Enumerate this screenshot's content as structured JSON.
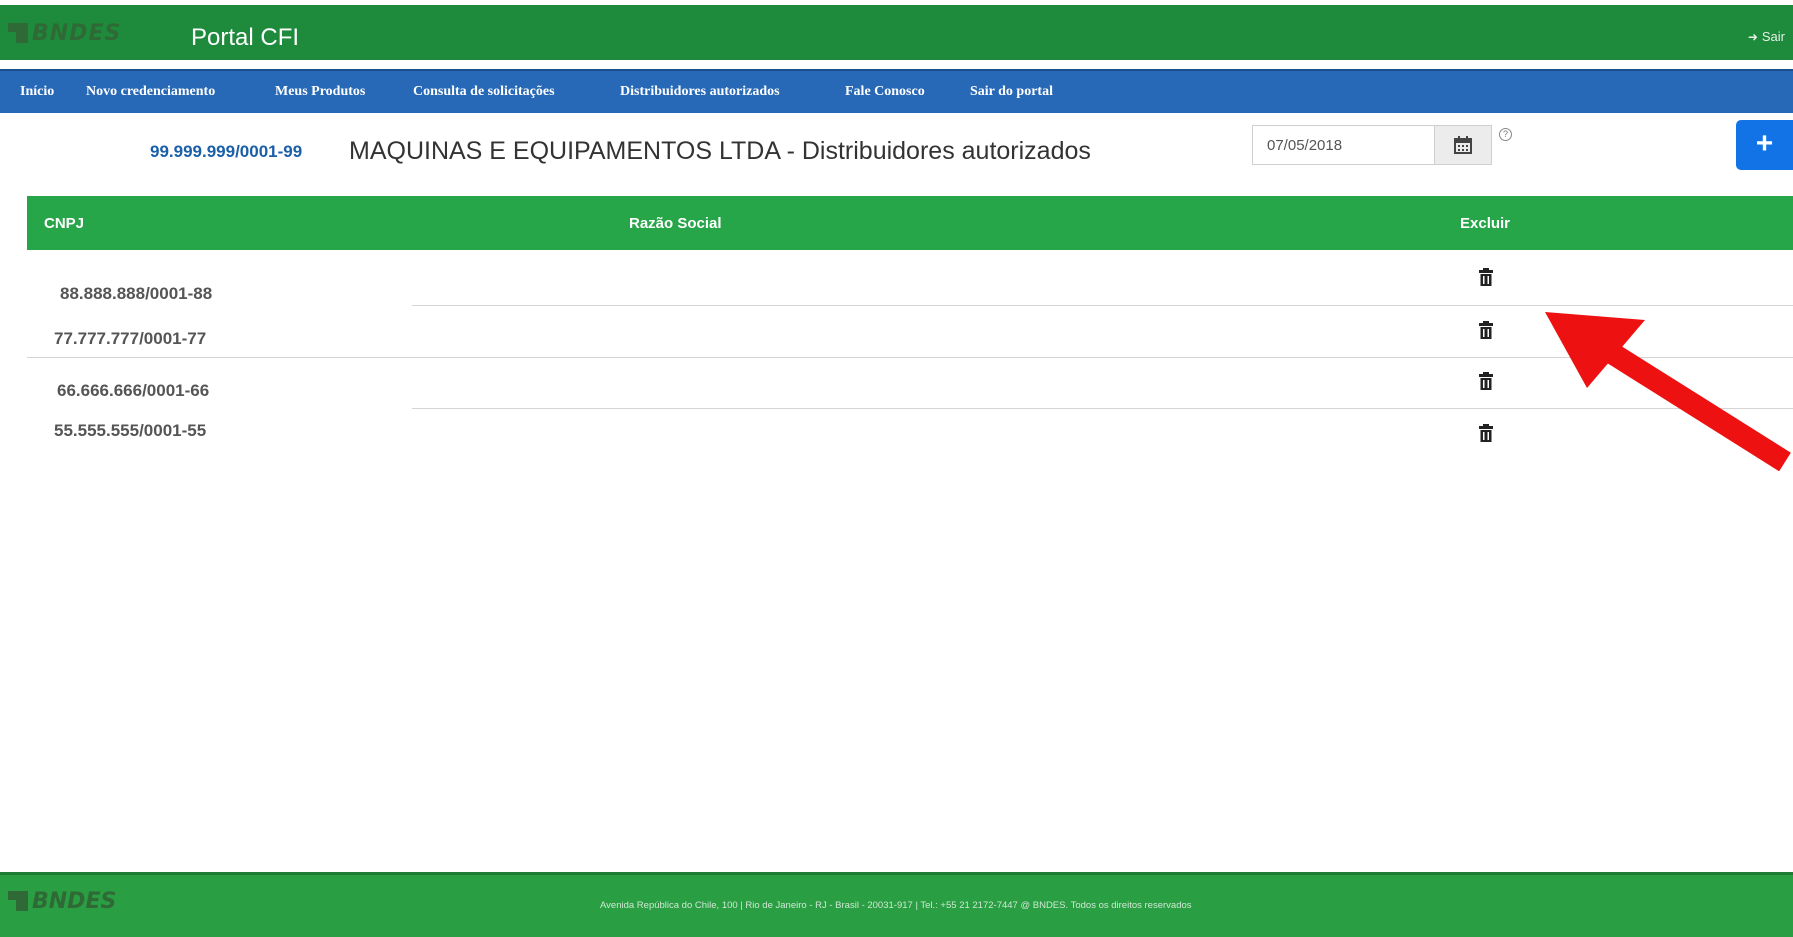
{
  "header": {
    "logo": "BNDES",
    "app_title": "Portal CFI",
    "logout_label": "Sair"
  },
  "nav": {
    "items": [
      {
        "label": "Início"
      },
      {
        "label": "Novo credenciamento"
      },
      {
        "label": "Meus Produtos"
      },
      {
        "label": "Consulta de solicitações"
      },
      {
        "label": "Distribuidores autorizados"
      },
      {
        "label": "Fale Conosco"
      },
      {
        "label": "Sair do portal"
      }
    ]
  },
  "page": {
    "company_cnpj": "99.999.999/0001-99",
    "title": "MAQUINAS E EQUIPAMENTOS LTDA - Distribuidores autorizados",
    "date_value": "07/05/2018",
    "add_label": "+"
  },
  "table": {
    "headers": {
      "cnpj": "CNPJ",
      "razao_social": "Razão Social",
      "excluir": "Excluir"
    },
    "rows": [
      {
        "cnpj": "88.888.888/0001-88"
      },
      {
        "cnpj": "77.777.777/0001-77"
      },
      {
        "cnpj": "66.666.666/0001-66"
      },
      {
        "cnpj": "55.555.555/0001-55"
      }
    ]
  },
  "footer": {
    "logo": "BNDES",
    "address": "Avenida República do Chile, 100 | Rio de Janeiro - RJ - Brasil - 20031-917 | Tel.: +55 21 2172-7447 @ BNDES. Todos os direitos reservados"
  },
  "colors": {
    "header_green": "#1e8a3c",
    "nav_blue": "#2769b7",
    "table_header_green": "#26a648",
    "add_button_blue": "#1173e6",
    "annotation_arrow": "#ee1111"
  }
}
